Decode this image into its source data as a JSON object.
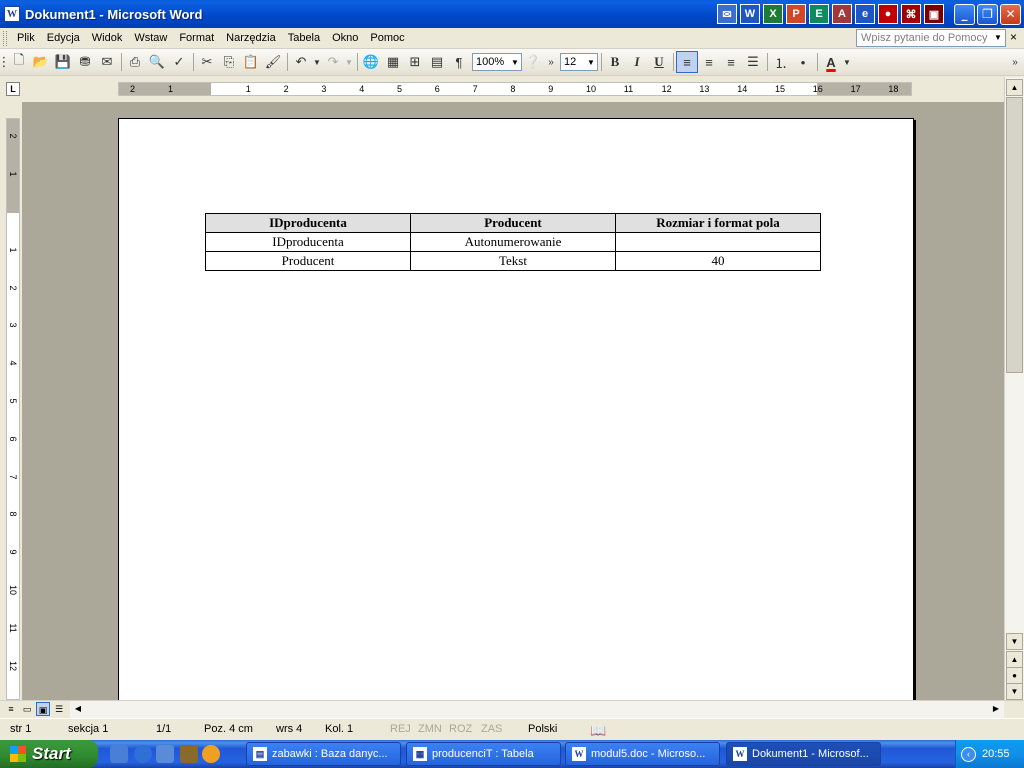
{
  "window": {
    "title": "Dokument1 - Microsoft Word",
    "app_icon": "W",
    "office_shortcuts": [
      "outlook-icon",
      "word-icon",
      "excel-icon",
      "powerpoint-icon",
      "publisher-icon",
      "access-icon",
      "ie-icon",
      "frontpage-icon",
      "calculator-icon",
      "save-icon"
    ],
    "controls": [
      "minimize",
      "restore",
      "close"
    ]
  },
  "menu": {
    "items": [
      "Plik",
      "Edycja",
      "Widok",
      "Wstaw",
      "Format",
      "Narzędzia",
      "Tabela",
      "Okno",
      "Pomoc"
    ],
    "help_placeholder": "Wpisz pytanie do Pomocy",
    "close_doc": "×"
  },
  "toolbar": {
    "zoom": "100%",
    "font_size": "12",
    "bold": "B",
    "italic": "I",
    "underline": "U",
    "pilcrow": "¶",
    "font_color_letter": "A",
    "font_color": "#ff0000"
  },
  "ruler": {
    "corner": "L",
    "labels": [
      "2",
      "1",
      "1",
      "2",
      "3",
      "4",
      "5",
      "6",
      "7",
      "8",
      "9",
      "10",
      "11",
      "12",
      "13",
      "14",
      "15",
      "16",
      "17",
      "18"
    ],
    "vlabels": [
      "2",
      "1",
      "1",
      "2",
      "3",
      "4",
      "5",
      "6",
      "7",
      "8",
      "9",
      "10",
      "11",
      "12"
    ]
  },
  "document": {
    "table": {
      "headers": [
        "IDproducenta",
        "Producent",
        "Rozmiar i format pola"
      ],
      "rows": [
        [
          "IDproducenta",
          "Autonumerowanie",
          ""
        ],
        [
          "Producent",
          "Tekst",
          "40"
        ]
      ]
    }
  },
  "status": {
    "page": "str 1",
    "section": "sekcja 1",
    "pages": "1/1",
    "position": "Poz. 4 cm",
    "line": "wrs 4",
    "column": "Kol. 1",
    "rej": "REJ",
    "zmn": "ZMN",
    "roz": "ROZ",
    "zas": "ZAS",
    "language": "Polski"
  },
  "taskbar": {
    "start": "Start",
    "tasks": [
      {
        "label": "zabawki : Baza danyc...",
        "icon": "access-db-icon"
      },
      {
        "label": "producenciT : Tabela",
        "icon": "table-icon"
      },
      {
        "label": "modul5.doc - Microso...",
        "icon": "word-doc-icon"
      },
      {
        "label": "Dokument1 - Microsof...",
        "icon": "word-doc-icon",
        "active": true
      }
    ],
    "clock": "20:55"
  }
}
